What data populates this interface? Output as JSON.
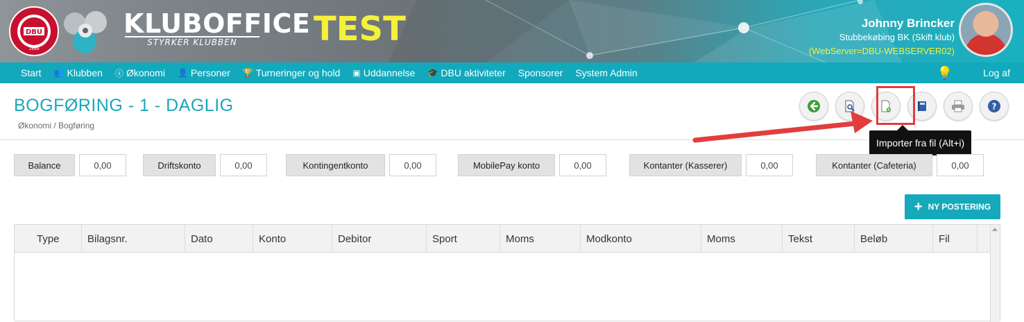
{
  "brand": {
    "title": "KLUBOFFICE",
    "slogan": "STYRKER KLUBBEN",
    "env": "TEST",
    "dbu_logo_text": "DANSK BOLDSPIL UNION · DBU · 1889"
  },
  "user": {
    "name": "Johnny Brincker",
    "club": "Stubbekøbing BK (Skift klub)",
    "server": "(WebServer=DBU-WEBSERVER02)"
  },
  "nav": {
    "items": [
      {
        "label": "Start",
        "icon": ""
      },
      {
        "label": "Klubben",
        "icon": "people-icon"
      },
      {
        "label": "Økonomi",
        "icon": "coin-icon"
      },
      {
        "label": "Personer",
        "icon": "person-icon"
      },
      {
        "label": "Turneringer og hold",
        "icon": "trophy-icon"
      },
      {
        "label": "Uddannelse",
        "icon": "presentation-icon"
      },
      {
        "label": "DBU aktiviteter",
        "icon": "graduation-cap-icon"
      },
      {
        "label": "Sponsorer",
        "icon": ""
      },
      {
        "label": "System Admin",
        "icon": ""
      }
    ],
    "logout": "Log af",
    "bulb_icon": "lightbulb-icon"
  },
  "page": {
    "title": "BOGFØRING - 1 - DAGLIG",
    "breadcrumb": "Økonomi / Bogføring"
  },
  "toolbar": {
    "buttons": [
      {
        "name": "back-button",
        "icon": "arrow-left-icon"
      },
      {
        "name": "search-document-button",
        "icon": "document-search-icon"
      },
      {
        "name": "import-file-button",
        "icon": "document-add-icon"
      },
      {
        "name": "book-button",
        "icon": "book-icon"
      },
      {
        "name": "print-button",
        "icon": "printer-icon"
      },
      {
        "name": "help-button",
        "icon": "help-icon"
      }
    ],
    "tooltip": "Importer fra fil (Alt+i)"
  },
  "accounts": [
    {
      "label": "Balance",
      "value": "0,00"
    },
    {
      "label": "Driftskonto",
      "value": "0,00"
    },
    {
      "label": "Kontingentkonto",
      "value": "0,00"
    },
    {
      "label": "MobilePay konto",
      "value": "0,00"
    },
    {
      "label": "Kontanter (Kasserer)",
      "value": "0,00"
    },
    {
      "label": "Kontanter (Cafeteria)",
      "value": "0,00"
    }
  ],
  "new_posting": "NY POSTERING",
  "table": {
    "columns": [
      "Type",
      "Bilagsnr.",
      "Dato",
      "Konto",
      "Debitor",
      "Sport",
      "Moms",
      "Modkonto",
      "Moms",
      "Tekst",
      "Beløb",
      "Fil"
    ]
  },
  "colors": {
    "accent": "#12a9bc",
    "title": "#19a7b9",
    "env": "#f5f03c",
    "annotation": "#e23d3d"
  }
}
